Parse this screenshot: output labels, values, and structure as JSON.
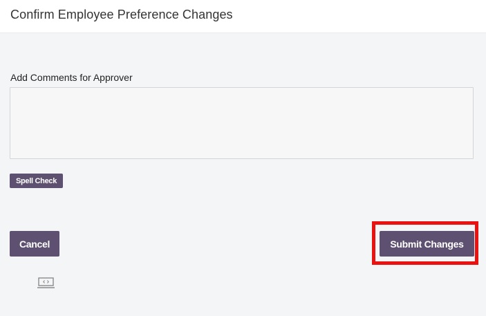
{
  "header": {
    "title": "Confirm Employee Preference Changes"
  },
  "comments": {
    "label": "Add Comments for Approver",
    "value": "",
    "placeholder": ""
  },
  "buttons": {
    "spell_check": "Spell Check",
    "cancel": "Cancel",
    "submit": "Submit Changes"
  },
  "colors": {
    "button_bg": "#5e5070",
    "highlight": "#ea1111",
    "page_bg": "#f4f5f7"
  },
  "icons": {
    "footer_icon": "screen-code-icon"
  }
}
